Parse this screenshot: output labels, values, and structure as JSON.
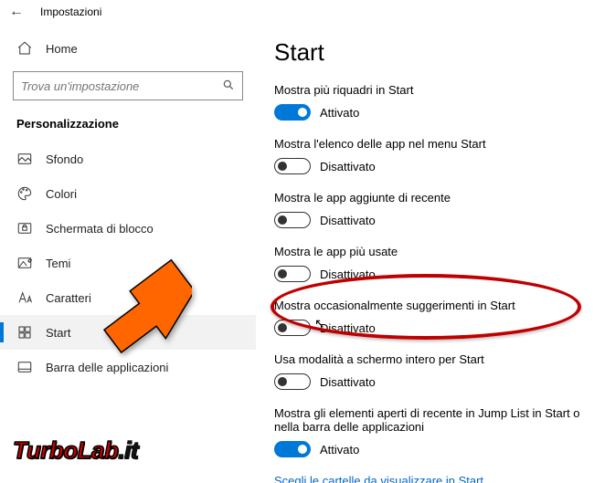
{
  "header": {
    "title": "Impostazioni"
  },
  "sidebar": {
    "home": "Home",
    "search_placeholder": "Trova un'impostazione",
    "section": "Personalizzazione",
    "items": [
      {
        "label": "Sfondo"
      },
      {
        "label": "Colori"
      },
      {
        "label": "Schermata di blocco"
      },
      {
        "label": "Temi"
      },
      {
        "label": "Caratteri"
      },
      {
        "label": "Start"
      },
      {
        "label": "Barra delle applicazioni"
      }
    ]
  },
  "content": {
    "title": "Start",
    "settings": [
      {
        "label": "Mostra più riquadri in Start",
        "state": "Attivato",
        "on": true
      },
      {
        "label": "Mostra l'elenco delle app nel menu Start",
        "state": "Disattivato",
        "on": false
      },
      {
        "label": "Mostra le app aggiunte di recente",
        "state": "Disattivato",
        "on": false
      },
      {
        "label": "Mostra le app più usate",
        "state": "Disattivato",
        "on": false
      },
      {
        "label": "Mostra occasionalmente suggerimenti in Start",
        "state": "Disattivato",
        "on": false
      },
      {
        "label": "Usa modalità a schermo intero per Start",
        "state": "Disattivato",
        "on": false
      },
      {
        "label": "Mostra gli elementi aperti di recente in Jump List in Start o nella barra delle applicazioni",
        "state": "Attivato",
        "on": true
      }
    ],
    "link": "Scegli le cartelle da visualizzare in Start"
  },
  "watermark": "TurboLab.it"
}
